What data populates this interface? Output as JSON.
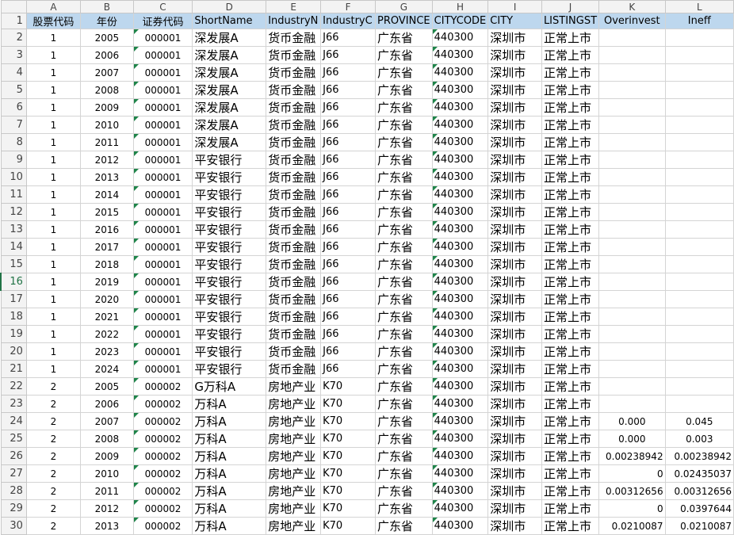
{
  "colors": {
    "header_fill": "#bdd7ee",
    "error_indicator": "#1e8449",
    "selected_row_marker": "#217346"
  },
  "column_letters": [
    "A",
    "B",
    "C",
    "D",
    "E",
    "F",
    "G",
    "H",
    "I",
    "J",
    "K",
    "L"
  ],
  "headers": [
    "股票代码",
    "年份",
    "证券代码",
    "ShortName",
    "IndustryN",
    "IndustryC",
    "PROVINCE",
    "CITYCODE",
    "CITY",
    "LISTINGST",
    "Overinvest",
    "Ineff"
  ],
  "rows": [
    {
      "n": "2",
      "a": "1",
      "b": "2005",
      "c": "000001",
      "d": "深发展A",
      "e": "货币金融",
      "f": "J66",
      "g": "广东省",
      "h": "440300",
      "i": "深圳市",
      "j": "正常上市",
      "k": "",
      "l": ""
    },
    {
      "n": "3",
      "a": "1",
      "b": "2006",
      "c": "000001",
      "d": "深发展A",
      "e": "货币金融",
      "f": "J66",
      "g": "广东省",
      "h": "440300",
      "i": "深圳市",
      "j": "正常上市",
      "k": "",
      "l": ""
    },
    {
      "n": "4",
      "a": "1",
      "b": "2007",
      "c": "000001",
      "d": "深发展A",
      "e": "货币金融",
      "f": "J66",
      "g": "广东省",
      "h": "440300",
      "i": "深圳市",
      "j": "正常上市",
      "k": "",
      "l": ""
    },
    {
      "n": "5",
      "a": "1",
      "b": "2008",
      "c": "000001",
      "d": "深发展A",
      "e": "货币金融",
      "f": "J66",
      "g": "广东省",
      "h": "440300",
      "i": "深圳市",
      "j": "正常上市",
      "k": "",
      "l": ""
    },
    {
      "n": "6",
      "a": "1",
      "b": "2009",
      "c": "000001",
      "d": "深发展A",
      "e": "货币金融",
      "f": "J66",
      "g": "广东省",
      "h": "440300",
      "i": "深圳市",
      "j": "正常上市",
      "k": "",
      "l": ""
    },
    {
      "n": "7",
      "a": "1",
      "b": "2010",
      "c": "000001",
      "d": "深发展A",
      "e": "货币金融",
      "f": "J66",
      "g": "广东省",
      "h": "440300",
      "i": "深圳市",
      "j": "正常上市",
      "k": "",
      "l": ""
    },
    {
      "n": "8",
      "a": "1",
      "b": "2011",
      "c": "000001",
      "d": "深发展A",
      "e": "货币金融",
      "f": "J66",
      "g": "广东省",
      "h": "440300",
      "i": "深圳市",
      "j": "正常上市",
      "k": "",
      "l": ""
    },
    {
      "n": "9",
      "a": "1",
      "b": "2012",
      "c": "000001",
      "d": "平安银行",
      "e": "货币金融",
      "f": "J66",
      "g": "广东省",
      "h": "440300",
      "i": "深圳市",
      "j": "正常上市",
      "k": "",
      "l": ""
    },
    {
      "n": "10",
      "a": "1",
      "b": "2013",
      "c": "000001",
      "d": "平安银行",
      "e": "货币金融",
      "f": "J66",
      "g": "广东省",
      "h": "440300",
      "i": "深圳市",
      "j": "正常上市",
      "k": "",
      "l": ""
    },
    {
      "n": "11",
      "a": "1",
      "b": "2014",
      "c": "000001",
      "d": "平安银行",
      "e": "货币金融",
      "f": "J66",
      "g": "广东省",
      "h": "440300",
      "i": "深圳市",
      "j": "正常上市",
      "k": "",
      "l": ""
    },
    {
      "n": "12",
      "a": "1",
      "b": "2015",
      "c": "000001",
      "d": "平安银行",
      "e": "货币金融",
      "f": "J66",
      "g": "广东省",
      "h": "440300",
      "i": "深圳市",
      "j": "正常上市",
      "k": "",
      "l": ""
    },
    {
      "n": "13",
      "a": "1",
      "b": "2016",
      "c": "000001",
      "d": "平安银行",
      "e": "货币金融",
      "f": "J66",
      "g": "广东省",
      "h": "440300",
      "i": "深圳市",
      "j": "正常上市",
      "k": "",
      "l": ""
    },
    {
      "n": "14",
      "a": "1",
      "b": "2017",
      "c": "000001",
      "d": "平安银行",
      "e": "货币金融",
      "f": "J66",
      "g": "广东省",
      "h": "440300",
      "i": "深圳市",
      "j": "正常上市",
      "k": "",
      "l": ""
    },
    {
      "n": "15",
      "a": "1",
      "b": "2018",
      "c": "000001",
      "d": "平安银行",
      "e": "货币金融",
      "f": "J66",
      "g": "广东省",
      "h": "440300",
      "i": "深圳市",
      "j": "正常上市",
      "k": "",
      "l": ""
    },
    {
      "n": "16",
      "a": "1",
      "b": "2019",
      "c": "000001",
      "d": "平安银行",
      "e": "货币金融",
      "f": "J66",
      "g": "广东省",
      "h": "440300",
      "i": "深圳市",
      "j": "正常上市",
      "k": "",
      "l": ""
    },
    {
      "n": "17",
      "a": "1",
      "b": "2020",
      "c": "000001",
      "d": "平安银行",
      "e": "货币金融",
      "f": "J66",
      "g": "广东省",
      "h": "440300",
      "i": "深圳市",
      "j": "正常上市",
      "k": "",
      "l": ""
    },
    {
      "n": "18",
      "a": "1",
      "b": "2021",
      "c": "000001",
      "d": "平安银行",
      "e": "货币金融",
      "f": "J66",
      "g": "广东省",
      "h": "440300",
      "i": "深圳市",
      "j": "正常上市",
      "k": "",
      "l": ""
    },
    {
      "n": "19",
      "a": "1",
      "b": "2022",
      "c": "000001",
      "d": "平安银行",
      "e": "货币金融",
      "f": "J66",
      "g": "广东省",
      "h": "440300",
      "i": "深圳市",
      "j": "正常上市",
      "k": "",
      "l": ""
    },
    {
      "n": "20",
      "a": "1",
      "b": "2023",
      "c": "000001",
      "d": "平安银行",
      "e": "货币金融",
      "f": "J66",
      "g": "广东省",
      "h": "440300",
      "i": "深圳市",
      "j": "正常上市",
      "k": "",
      "l": ""
    },
    {
      "n": "21",
      "a": "1",
      "b": "2024",
      "c": "000001",
      "d": "平安银行",
      "e": "货币金融",
      "f": "J66",
      "g": "广东省",
      "h": "440300",
      "i": "深圳市",
      "j": "正常上市",
      "k": "",
      "l": ""
    },
    {
      "n": "22",
      "a": "2",
      "b": "2005",
      "c": "000002",
      "d": "G万科A",
      "e": "房地产业",
      "f": "K70",
      "g": "广东省",
      "h": "440300",
      "i": "深圳市",
      "j": "正常上市",
      "k": "",
      "l": ""
    },
    {
      "n": "23",
      "a": "2",
      "b": "2006",
      "c": "000002",
      "d": "万科A",
      "e": "房地产业",
      "f": "K70",
      "g": "广东省",
      "h": "440300",
      "i": "深圳市",
      "j": "正常上市",
      "k": "",
      "l": ""
    },
    {
      "n": "24",
      "a": "2",
      "b": "2007",
      "c": "000002",
      "d": "万科A",
      "e": "房地产业",
      "f": "K70",
      "g": "广东省",
      "h": "440300",
      "i": "深圳市",
      "j": "正常上市",
      "k": "0.000",
      "l": "0.045"
    },
    {
      "n": "25",
      "a": "2",
      "b": "2008",
      "c": "000002",
      "d": "万科A",
      "e": "房地产业",
      "f": "K70",
      "g": "广东省",
      "h": "440300",
      "i": "深圳市",
      "j": "正常上市",
      "k": "0.000",
      "l": "0.003"
    },
    {
      "n": "26",
      "a": "2",
      "b": "2009",
      "c": "000002",
      "d": "万科A",
      "e": "房地产业",
      "f": "K70",
      "g": "广东省",
      "h": "440300",
      "i": "深圳市",
      "j": "正常上市",
      "k": "0.00238942",
      "l": "0.00238942"
    },
    {
      "n": "27",
      "a": "2",
      "b": "2010",
      "c": "000002",
      "d": "万科A",
      "e": "房地产业",
      "f": "K70",
      "g": "广东省",
      "h": "440300",
      "i": "深圳市",
      "j": "正常上市",
      "k": "0",
      "l": "0.02435037"
    },
    {
      "n": "28",
      "a": "2",
      "b": "2011",
      "c": "000002",
      "d": "万科A",
      "e": "房地产业",
      "f": "K70",
      "g": "广东省",
      "h": "440300",
      "i": "深圳市",
      "j": "正常上市",
      "k": "0.00312656",
      "l": "0.00312656"
    },
    {
      "n": "29",
      "a": "2",
      "b": "2012",
      "c": "000002",
      "d": "万科A",
      "e": "房地产业",
      "f": "K70",
      "g": "广东省",
      "h": "440300",
      "i": "深圳市",
      "j": "正常上市",
      "k": "0",
      "l": "0.0397644"
    },
    {
      "n": "30",
      "a": "2",
      "b": "2013",
      "c": "000002",
      "d": "万科A",
      "e": "房地产业",
      "f": "K70",
      "g": "广东省",
      "h": "440300",
      "i": "深圳市",
      "j": "正常上市",
      "k": "0.0210087",
      "l": "0.0210087"
    }
  ]
}
